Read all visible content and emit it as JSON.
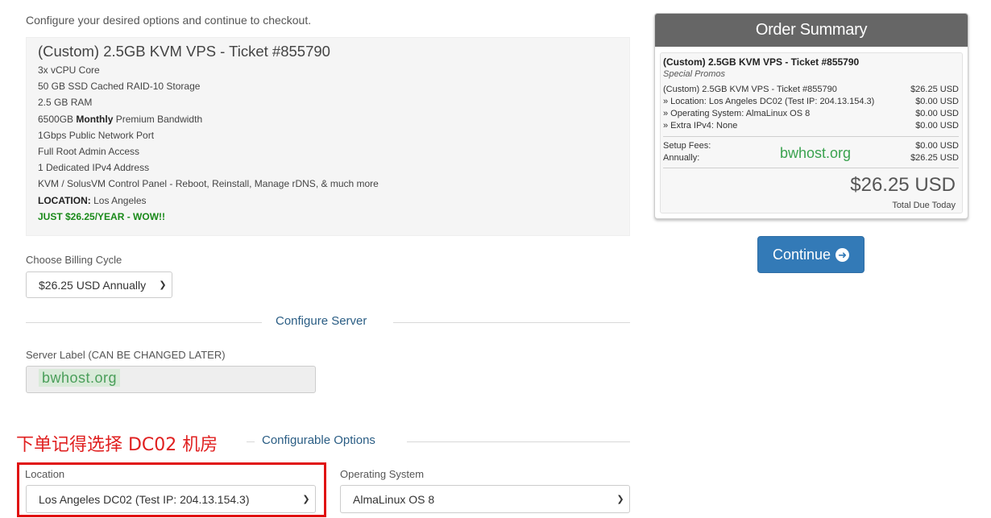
{
  "intro_text": "Configure your desired options and continue to checkout.",
  "product": {
    "title": "(Custom) 2.5GB KVM VPS - Ticket #855790",
    "features": [
      "3x vCPU Core",
      "50 GB SSD Cached RAID-10 Storage",
      "2.5 GB RAM"
    ],
    "bandwidth_prefix": "6500GB",
    "bandwidth_bold": "Monthly",
    "bandwidth_suffix": "Premium Bandwidth",
    "features2": [
      "1Gbps Public Network Port",
      "Full Root Admin Access",
      "1 Dedicated IPv4 Address",
      "KVM / SolusVM Control Panel - Reboot, Reinstall, Manage rDNS, & much more"
    ],
    "location_label": "LOCATION:",
    "location_value": "Los Angeles",
    "promo": "JUST $26.25/YEAR - WOW!!"
  },
  "billing": {
    "label": "Choose Billing Cycle",
    "value": "$26.25 USD Annually"
  },
  "configure_server": {
    "title": "Configure Server",
    "server_label": "Server Label (CAN BE CHANGED LATER)",
    "server_label_value": "bwhost.org"
  },
  "configurable_options": {
    "title": "Configurable Options",
    "note": "下单记得选择 DC02 机房",
    "location_label": "Location",
    "location_value": "Los Angeles DC02 (Test IP: 204.13.154.3)",
    "os_label": "Operating System",
    "os_value": "AlmaLinux OS 8"
  },
  "summary": {
    "heading": "Order Summary",
    "product": "(Custom) 2.5GB KVM VPS - Ticket #855790",
    "category": "Special Promos",
    "rows": [
      {
        "label": "(Custom) 2.5GB KVM VPS - Ticket #855790",
        "price": "$26.25 USD"
      },
      {
        "label": "» Location: Los Angeles DC02 (Test IP: 204.13.154.3)",
        "price": "$0.00 USD"
      },
      {
        "label": "» Operating System: AlmaLinux OS 8",
        "price": "$0.00 USD"
      },
      {
        "label": "» Extra IPv4: None",
        "price": "$0.00 USD"
      }
    ],
    "setup_label": "Setup Fees:",
    "setup_price": "$0.00 USD",
    "annual_label": "Annually:",
    "annual_price": "$26.25 USD",
    "watermark": "bwhost.org",
    "total": "$26.25 USD",
    "total_label": "Total Due Today"
  },
  "continue_label": "Continue"
}
